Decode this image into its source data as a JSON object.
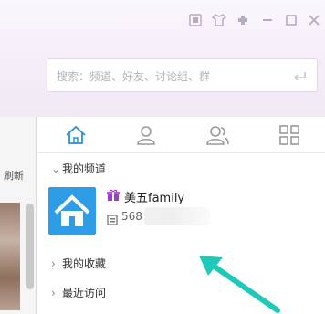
{
  "search": {
    "placeholder": "搜索：频道、好友、讨论组、群"
  },
  "left_pane": {
    "refresh_label": "刷新"
  },
  "tabs": [
    {
      "name": "home",
      "icon": "home-icon",
      "active": true
    },
    {
      "name": "contacts",
      "icon": "person-icon",
      "active": false
    },
    {
      "name": "groups",
      "icon": "people-icon",
      "active": false
    },
    {
      "name": "apps",
      "icon": "grid-icon",
      "active": false
    }
  ],
  "sections": {
    "my_channels": "我的频道",
    "my_favorites": "我的收藏",
    "recent_visits": "最近访问"
  },
  "channel": {
    "name": "美五family",
    "id_prefix": "568"
  },
  "colors": {
    "accent": "#2a8fd8",
    "logo_bg": "#2e9ce6",
    "badge": "#9b3fc7",
    "annotation_arrow": "#1fc9b8"
  }
}
